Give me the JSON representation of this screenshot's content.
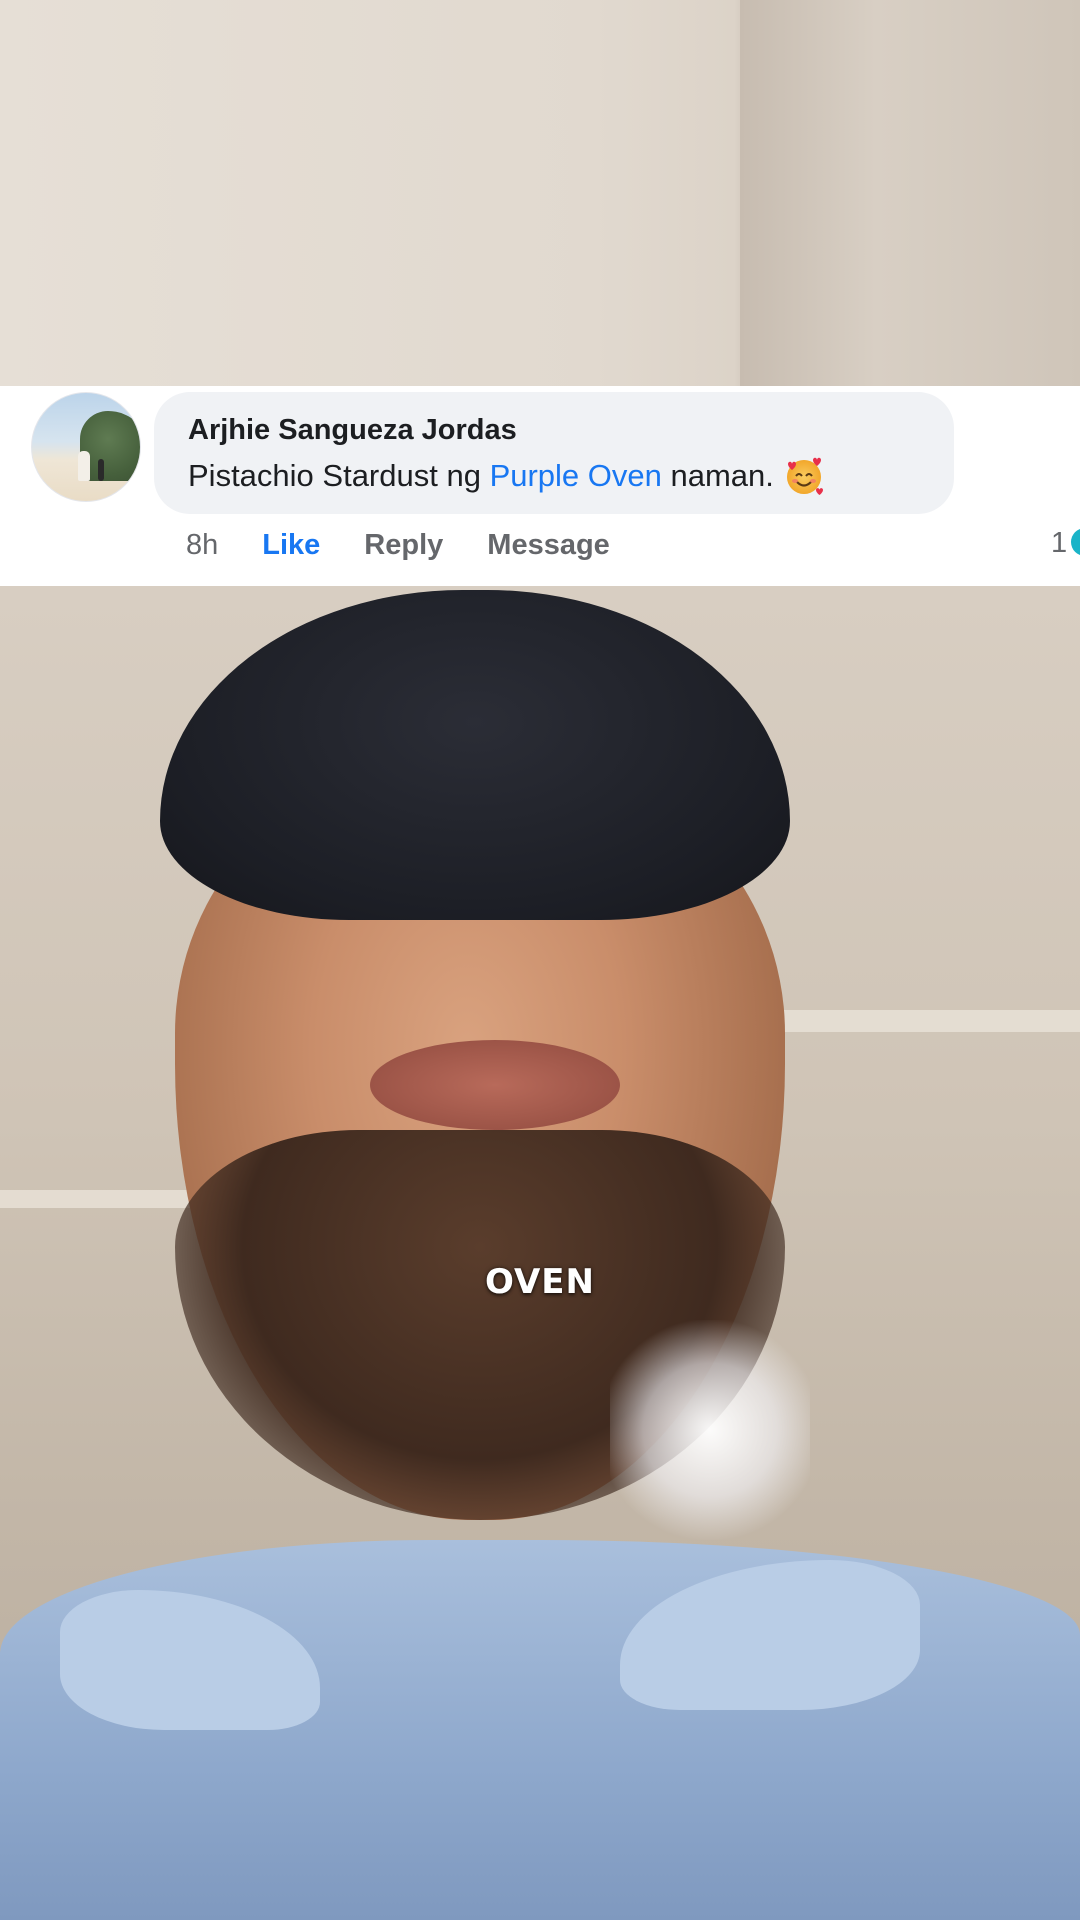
{
  "comment": {
    "author": "Arjhie Sangueza Jordas",
    "text_before": "Pistachio Stardust ng ",
    "mention": "Purple Oven",
    "text_after": " naman.",
    "emoji": "smiling-face-with-hearts-icon",
    "time": "8h",
    "like_label": "Like",
    "reply_label": "Reply",
    "message_label": "Message",
    "reaction_count": "1"
  },
  "video": {
    "subtitle": "OVEN"
  },
  "colors": {
    "link": "#1877f2",
    "secondary_text": "#65676b",
    "bubble": "#f0f2f5"
  }
}
